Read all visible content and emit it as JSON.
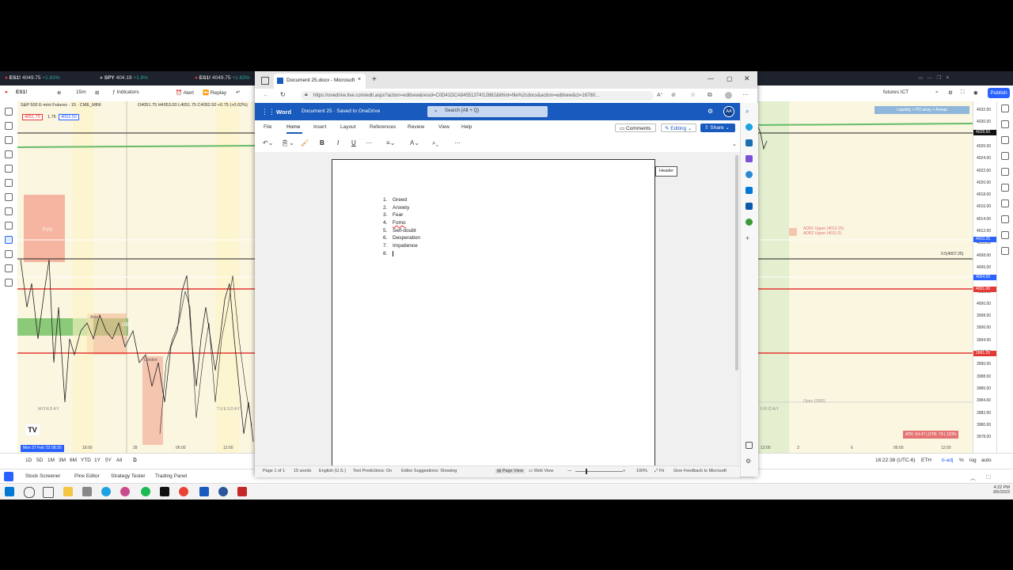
{
  "tradingview": {
    "tabs": [
      {
        "symbol": "ES1!",
        "price": "4049.75",
        "change": "+1.63%"
      },
      {
        "symbol": "SPY",
        "price": "404.19",
        "change": "+1.6%"
      },
      {
        "symbol": "ES1!",
        "price": "4049.75",
        "change": "+1.63%"
      }
    ],
    "toolbar": {
      "symbol": "ES1!",
      "interval": "15m",
      "indicators": "Indicators",
      "alert": "Alert",
      "replay": "Replay",
      "layout_name": "futures ICT",
      "publish": "Publish"
    },
    "legend": {
      "title": "S&P 500 E-mini Futures · 15 · CME_MINI",
      "ohlc": "O4051.75 H4053.00 L4051.75 C4052.50 +0.75 (+0.02%)",
      "bid": "4051.75",
      "spread": "1.75",
      "ask": "4053.50"
    },
    "chart_labels": {
      "fvg": "FVG",
      "ob": "OB+",
      "asia": "Asia",
      "london": "London",
      "monday": "MONDAY",
      "tuesday": "TUESDAY",
      "friday": "FRIDAY",
      "liquidity": "Liquidity > PD array > Avwap",
      "adr1": "ADR1 Upper (4012.25)",
      "adr2": "ADR2 Upper (4011.5)",
      "open": "Open (3982)",
      "half": "0.5(4007.25)",
      "date_badge": "Mon 27 Feb '23  08:30"
    },
    "price_ticks": [
      "4032.00",
      "4030.00",
      "4028.00",
      "4026.00",
      "4024.00",
      "4022.00",
      "4020.00",
      "4018.00",
      "4016.00",
      "4014.00",
      "4012.00",
      "4010.00",
      "4008.00",
      "4006.00",
      "4004.00",
      "4002.00",
      "4000.00",
      "3998.00",
      "3996.00",
      "3994.00",
      "3992.00",
      "3990.00",
      "3988.00",
      "3986.00",
      "3984.00",
      "3982.00",
      "3980.00",
      "3978.00"
    ],
    "price_highlights": {
      "current": "4028.50",
      "p1": "4010.25",
      "p2": "4004.00",
      "p3": "4001.00",
      "p4": "3991.25"
    },
    "time_ticks_left": [
      "18:00",
      "28",
      "06:00",
      "12:00"
    ],
    "time_ticks_right": [
      "12:00",
      "3",
      "6",
      "06:00",
      "12:00"
    ],
    "atr_label": "ATR: 64.47 | DTR: 79 | 123%",
    "range_buttons": [
      "1D",
      "5D",
      "1M",
      "3M",
      "6M",
      "YTD",
      "1Y",
      "5Y",
      "All"
    ],
    "clock": "16:22:38 (UTC-6)",
    "session": "ETH",
    "adj": "b-adj",
    "pct": "%",
    "log": "log",
    "auto": "auto",
    "panels": [
      "Stock Screener",
      "Pine Editor",
      "Strategy Tester",
      "Trading Panel"
    ]
  },
  "browser": {
    "tab_title": "Document 25.docx - Microsoft W",
    "url": "https://onedrive.live.com/edit.aspx?action=editnew&resid=C0D41DCA84551374!12862&ithint=file%2cdocx&action=editnew&ct=16780...",
    "new_tab": "+"
  },
  "word": {
    "app_name": "Word",
    "doc_title": "Document 25  ·  Saved to OneDrive",
    "search_placeholder": "Search (Alt + Q)",
    "avatar": "AA",
    "ribbon_tabs": [
      "File",
      "Home",
      "Insert",
      "Layout",
      "References",
      "Review",
      "View",
      "Help"
    ],
    "comments": "Comments",
    "editing": "Editing",
    "share": "Share",
    "header_tag": "Header",
    "list_items": [
      "Greed",
      "Anxiety",
      "Fear",
      "Fomo",
      "Self-doubt",
      "Desperation",
      "Impatience",
      ""
    ],
    "status": {
      "page": "Page 1 of 1",
      "words": "15 words",
      "language": "English (U.S.)",
      "text_predictions": "Text Predictions: On",
      "editor_suggestions": "Editor Suggestions: Showing",
      "page_view": "Page View",
      "web_view": "Web View",
      "zoom": "100%",
      "fit": "Fit",
      "feedback": "Give Feedback to Microsoft"
    }
  },
  "taskbar": {
    "time": "4:22 PM",
    "date": "3/5/2023"
  },
  "colors": {
    "word_blue": "#185abd",
    "tv_red": "#e53935",
    "tv_green": "#26a69a",
    "chart_bg": "#faf6e0"
  }
}
